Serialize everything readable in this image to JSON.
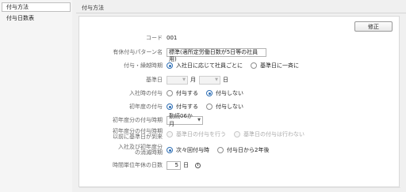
{
  "sidebar": {
    "items": [
      {
        "label": "付与方法"
      },
      {
        "label": "付与日数表"
      }
    ]
  },
  "main": {
    "section_title": "付与方法",
    "edit_button": "修正",
    "fields": {
      "code": {
        "label": "コード",
        "value": "001"
      },
      "pattern_name": {
        "label": "有休付与パターン名",
        "value": "標準(適所定労働日数が5日等の社員用)"
      },
      "timing": {
        "label": "付与・繰越時期",
        "options": [
          "入社日に応じて社員ごとに",
          "基準日に一斉に"
        ],
        "selected": 0
      },
      "base_date": {
        "label": "基準日",
        "month_unit": "月",
        "day_unit": "日"
      },
      "on_hire": {
        "label": "入社時の付与",
        "options": [
          "付与する",
          "付与しない"
        ],
        "selected": 1
      },
      "first_year": {
        "label": "初年度の付与",
        "options": [
          "付与する",
          "付与しない"
        ],
        "selected": 0
      },
      "first_year_timing": {
        "label": "初年度分の付与時期",
        "value": "勤続06か月"
      },
      "before_base": {
        "label_line1": "初年度分の付与時期",
        "label_line2": "以前に基準日が到来",
        "options": [
          "基準日の付与を行う",
          "基準日の付与は行わない"
        ],
        "selected": -1
      },
      "expiry": {
        "label_line1": "入社及び初年度分",
        "label_line2": "の消滅時期",
        "options": [
          "次々回付与時",
          "付与日から2年後"
        ],
        "selected": 0
      },
      "hourly_days": {
        "label": "時間単位年休の日数",
        "value": "5",
        "unit": "日"
      }
    }
  },
  "colors": {
    "accent": "#2f6fb5"
  }
}
